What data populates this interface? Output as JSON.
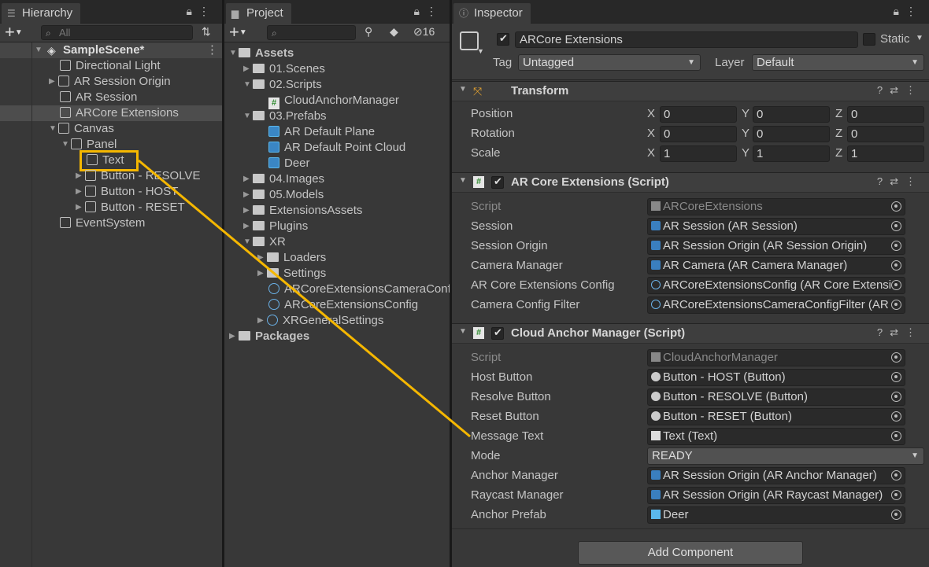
{
  "hierarchy": {
    "tab": "Hierarchy",
    "search_placeholder": "All",
    "scene": "SampleScene*",
    "items": [
      "Directional Light",
      "AR Session Origin",
      "AR Session",
      "ARCore Extensions",
      "Canvas",
      "Panel",
      "Text",
      "Button -  RESOLVE",
      "Button -  HOST",
      "Button -  RESET",
      "EventSystem"
    ]
  },
  "project": {
    "tab": "Project",
    "badge": "16",
    "items": [
      "Assets",
      "01.Scenes",
      "02.Scripts",
      "CloudAnchorManager",
      "03.Prefabs",
      "AR Default Plane",
      "AR Default Point Cloud",
      "Deer",
      "04.Images",
      "05.Models",
      "ExtensionsAssets",
      "Plugins",
      "XR",
      "Loaders",
      "Settings",
      "ARCoreExtensionsCameraConfig",
      "ARCoreExtensionsConfig",
      "XRGeneralSettings",
      "Packages"
    ]
  },
  "inspector": {
    "tab": "Inspector",
    "object_name": "ARCore Extensions",
    "static_label": "Static",
    "tag_label": "Tag",
    "tag_value": "Untagged",
    "layer_label": "Layer",
    "layer_value": "Default",
    "transform": {
      "title": "Transform",
      "position_label": "Position",
      "rotation_label": "Rotation",
      "scale_label": "Scale",
      "axes": [
        "X",
        "Y",
        "Z"
      ],
      "position": [
        "0",
        "0",
        "0"
      ],
      "rotation": [
        "0",
        "0",
        "0"
      ],
      "scale": [
        "1",
        "1",
        "1"
      ]
    },
    "arcore": {
      "title": "AR Core Extensions (Script)",
      "fields": [
        {
          "label": "Script",
          "value": "ARCoreExtensions"
        },
        {
          "label": "Session",
          "value": "AR Session (AR Session)"
        },
        {
          "label": "Session Origin",
          "value": "AR Session Origin (AR Session Origin)"
        },
        {
          "label": "Camera Manager",
          "value": "AR Camera (AR Camera Manager)"
        },
        {
          "label": "AR Core Extensions Config",
          "value": "ARCoreExtensionsConfig (AR Core Extensic"
        },
        {
          "label": "Camera Config Filter",
          "value": "ARCoreExtensionsCameraConfigFilter (AR C"
        }
      ]
    },
    "cloud": {
      "title": "Cloud Anchor Manager (Script)",
      "fields": [
        {
          "label": "Script",
          "value": "CloudAnchorManager"
        },
        {
          "label": "Host Button",
          "value": "Button -  HOST (Button)"
        },
        {
          "label": "Resolve Button",
          "value": "Button - RESOLVE (Button)"
        },
        {
          "label": "Reset Button",
          "value": "Button -  RESET (Button)"
        },
        {
          "label": "Message Text",
          "value": "Text (Text)"
        },
        {
          "label": "Mode",
          "value": "READY"
        },
        {
          "label": "Anchor Manager",
          "value": "AR Session Origin (AR Anchor Manager)"
        },
        {
          "label": "Raycast Manager",
          "value": "AR Session Origin (AR Raycast Manager)"
        },
        {
          "label": "Anchor Prefab",
          "value": "Deer"
        }
      ]
    },
    "add_component": "Add Component"
  },
  "colors": {
    "highlight": "#f5b700",
    "panel": "#383838",
    "selection": "#4d4d4d"
  }
}
